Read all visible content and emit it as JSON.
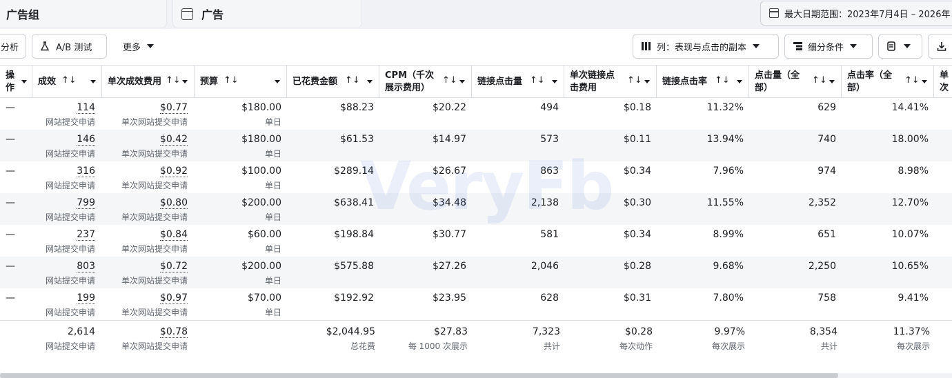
{
  "tabs": {
    "ad_sets": "广告组",
    "ads": "广告"
  },
  "date_range": "最大日期范围：2023年7月4日 – 2026年",
  "toolbar": {
    "analyze": "分析",
    "ab_test": "A/B 测试",
    "more": "更多",
    "columns": "列：表现与点击的副本",
    "breakdown": "细分条件",
    "export_icon": "download-icon",
    "reports_icon": "reports-icon"
  },
  "columns": {
    "actions": "操作",
    "results": "成效",
    "cost_per_result": "单次成效费用",
    "budget": "预算",
    "amount_spent": "已花费金额",
    "cpm": "CPM（千次展示费用）",
    "link_clicks": "链接点击量",
    "cpc_link": "单次链接点击费用",
    "ctr_link": "链接点击率",
    "clicks_all": "点击量（全部）",
    "ctr_all": "点击率（全部）",
    "cpc_all_partial": "单次"
  },
  "rows": [
    {
      "actions": "—",
      "results": "114",
      "results_sub": "网站提交申请",
      "cost": "$0.77",
      "cost_sub": "单次网站提交申请",
      "budget": "$180.00",
      "budget_sub": "单日",
      "spent": "$88.23",
      "cpm": "$20.22",
      "link_clicks": "494",
      "cpc_link": "$0.18",
      "ctr_link": "11.32%",
      "clicks_all": "629",
      "ctr_all": "14.41%"
    },
    {
      "actions": "—",
      "results": "146",
      "results_sub": "网站提交申请",
      "cost": "$0.42",
      "cost_sub": "单次网站提交申请",
      "budget": "$180.00",
      "budget_sub": "单日",
      "spent": "$61.53",
      "cpm": "$14.97",
      "link_clicks": "573",
      "cpc_link": "$0.11",
      "ctr_link": "13.94%",
      "clicks_all": "740",
      "ctr_all": "18.00%"
    },
    {
      "actions": "—",
      "results": "316",
      "results_sub": "网站提交申请",
      "cost": "$0.92",
      "cost_sub": "单次网站提交申请",
      "budget": "$100.00",
      "budget_sub": "单日",
      "spent": "$289.14",
      "cpm": "$26.67",
      "link_clicks": "863",
      "cpc_link": "$0.34",
      "ctr_link": "7.96%",
      "clicks_all": "974",
      "ctr_all": "8.98%"
    },
    {
      "actions": "—",
      "results": "799",
      "results_sub": "网站提交申请",
      "cost": "$0.80",
      "cost_sub": "单次网站提交申请",
      "budget": "$200.00",
      "budget_sub": "单日",
      "spent": "$638.41",
      "cpm": "$34.48",
      "link_clicks": "2,138",
      "cpc_link": "$0.30",
      "ctr_link": "11.55%",
      "clicks_all": "2,352",
      "ctr_all": "12.70%"
    },
    {
      "actions": "—",
      "results": "237",
      "results_sub": "网站提交申请",
      "cost": "$0.84",
      "cost_sub": "单次网站提交申请",
      "budget": "$60.00",
      "budget_sub": "单日",
      "spent": "$198.84",
      "cpm": "$30.77",
      "link_clicks": "581",
      "cpc_link": "$0.34",
      "ctr_link": "8.99%",
      "clicks_all": "651",
      "ctr_all": "10.07%"
    },
    {
      "actions": "—",
      "results": "803",
      "results_sub": "网站提交申请",
      "cost": "$0.72",
      "cost_sub": "单次网站提交申请",
      "budget": "$200.00",
      "budget_sub": "单日",
      "spent": "$575.88",
      "cpm": "$27.26",
      "link_clicks": "2,046",
      "cpc_link": "$0.28",
      "ctr_link": "9.68%",
      "clicks_all": "2,250",
      "ctr_all": "10.65%"
    },
    {
      "actions": "—",
      "results": "199",
      "results_sub": "网站提交申请",
      "cost": "$0.97",
      "cost_sub": "单次网站提交申请",
      "budget": "$70.00",
      "budget_sub": "单日",
      "spent": "$192.92",
      "cpm": "$23.95",
      "link_clicks": "628",
      "cpc_link": "$0.31",
      "ctr_link": "7.80%",
      "clicks_all": "758",
      "ctr_all": "9.41%"
    }
  ],
  "totals": {
    "results": "2,614",
    "results_sub": "网站提交申请",
    "cost": "$0.78",
    "cost_sub": "单次网站提交申请",
    "spent": "$2,044.95",
    "spent_sub": "总花费",
    "cpm": "$27.83",
    "cpm_sub": "每 1000 次展示",
    "link_clicks": "7,323",
    "link_clicks_sub": "共计",
    "cpc_link": "$0.28",
    "cpc_link_sub": "每次动作",
    "ctr_link": "9.97%",
    "ctr_link_sub": "每次展示",
    "clicks_all": "8,354",
    "clicks_all_sub": "共计",
    "ctr_all": "11.37%",
    "ctr_all_sub": "每次展示"
  },
  "watermark": "VeryFb"
}
